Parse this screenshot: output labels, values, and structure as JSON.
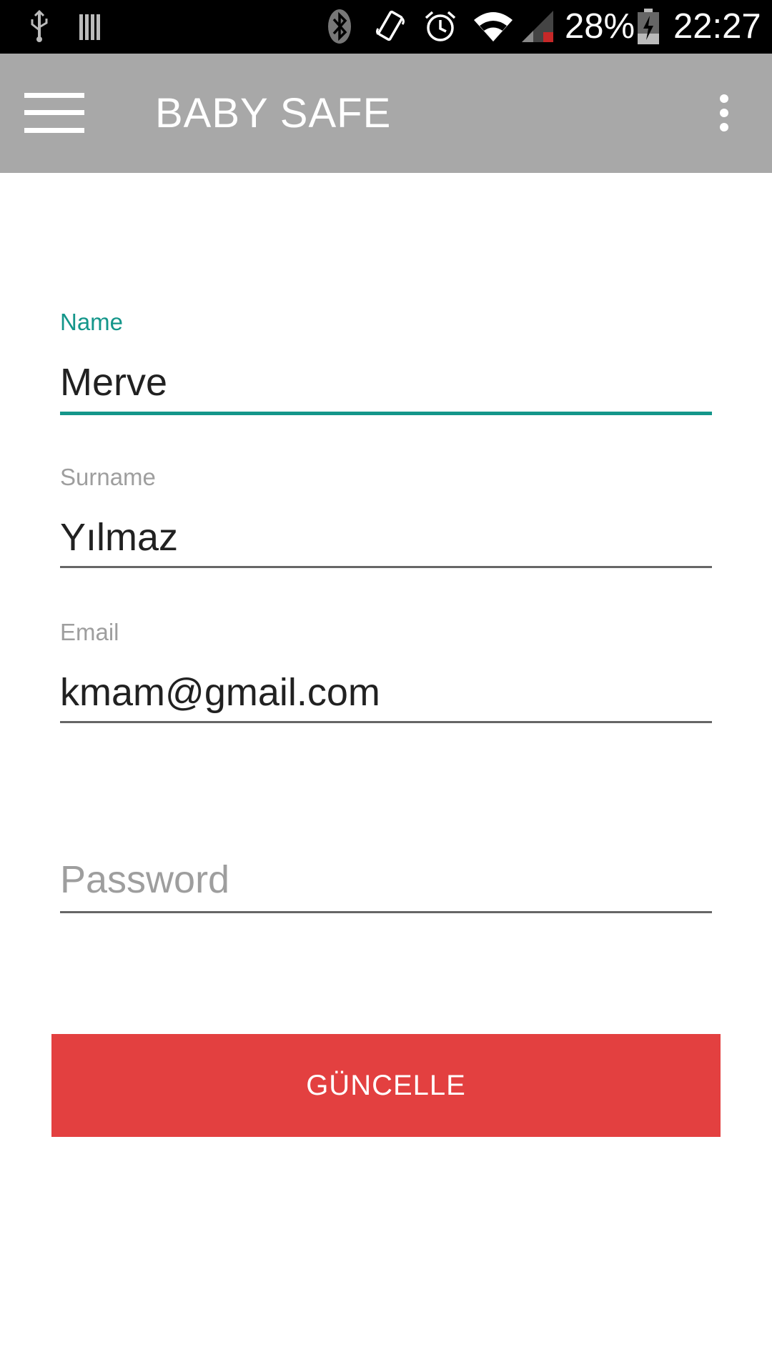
{
  "status_bar": {
    "icons": [
      "usb-icon",
      "sim-card-icon",
      "bluetooth-icon",
      "vibrate-icon",
      "alarm-icon",
      "wifi-icon",
      "cellular-signal-icon",
      "battery-charging-icon"
    ],
    "battery_percent": "28%",
    "time": "22:27"
  },
  "app_bar": {
    "title": "BABY SAFE",
    "menu_icon": "hamburger-menu-icon",
    "overflow_icon": "more-vert-icon",
    "background_color": "#a8a8a8"
  },
  "form": {
    "name": {
      "label": "Name",
      "value": "Merve",
      "focused": true
    },
    "surname": {
      "label": "Surname",
      "value": "Yılmaz"
    },
    "email": {
      "label": "Email",
      "value": "kmam@gmail.com"
    },
    "password": {
      "placeholder": "Password",
      "value": ""
    },
    "accent_color": "#14968a"
  },
  "update_button": {
    "label": "GÜNCELLE",
    "color": "#e34040"
  }
}
